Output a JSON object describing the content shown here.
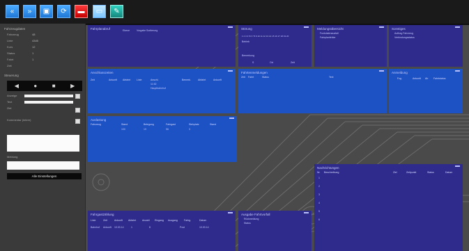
{
  "toolbar": {
    "buttons": [
      {
        "icon": "double-chevron-left-icon"
      },
      {
        "icon": "double-chevron-right-icon"
      },
      {
        "icon": "save-icon"
      },
      {
        "icon": "refresh-icon"
      },
      {
        "icon": "delete-icon"
      },
      {
        "icon": "window-icon"
      },
      {
        "icon": "edit-icon"
      }
    ]
  },
  "left": {
    "section1": "Fahrzeugdaten",
    "fields": [
      {
        "label": "Fahrzeug",
        "value": "48"
      },
      {
        "label": "Linie",
        "value": "4345"
      },
      {
        "label": "Kurs",
        "value": "12"
      },
      {
        "label": "Status",
        "value": "1"
      },
      {
        "label": "Fahrt",
        "value": "1"
      },
      {
        "label": "Zeit",
        "value": ""
      }
    ],
    "section2": "Steuerung",
    "f1": "Anzeige",
    "f2": "Text",
    "f3": "Ziel",
    "comment_label": "Kommentar (intern)",
    "text_label": "Meldung",
    "btn": "Alle Einstellungen"
  },
  "panels": {
    "p1_title": "Fahrplanabruf",
    "p1_sub1": "Ebene",
    "p1_sub2": "Vorgabe Sortierung",
    "p2_title": "Störung",
    "p2_row1": "1 2 3 4 5 6 7 8 9 10 11 12 13 14 15 16 17 18 19 20",
    "p2_row2": "Betrieb",
    "p2_row3": "Bemerkung",
    "p2_cols": [
      "S",
      "Ort",
      "Zeit"
    ],
    "p3_title": "Meldungsübersicht",
    "p3_rows": [
      "Funkdatenausfall",
      "Fahrplanfehler"
    ],
    "p4_title": "Sonstiges",
    "p4_rows": [
      "Auftrag Fahrzeug",
      "Verbindungsstatus"
    ],
    "p5_title": "Anschlusszeiten",
    "p5_cols": [
      "Zeit",
      "Ankunft",
      "Abfahrt",
      "Linie",
      "Anschl.",
      "Bemerk.",
      "Abfahrt",
      "Ankunft"
    ],
    "p5_rows": [
      "11:52",
      "Hauptbahnhof"
    ],
    "p6_title": "Fahrtenmeldungen",
    "p6_cols": [
      "Zeit",
      "Fahrt",
      "Status",
      "Text"
    ],
    "p7_title": "Anmeldung",
    "p7_cols": [
      "Fzg.",
      "Ankunft",
      "Ab",
      "Fahrtstatus"
    ],
    "p8_title": "Auslastung",
    "p8_cols": [
      "Fahrzeug",
      "Stand",
      "Belegung",
      "Fahrgast",
      "Stehplatz",
      "Stand"
    ],
    "p8_vals": [
      "100",
      "19",
      "56",
      "3"
    ],
    "p9_title": "Nachrichtungen",
    "p9_cols": [
      "Nr.",
      "Beschreibung",
      "Ziel",
      "Zeitpunkt",
      "Status",
      "Datum"
    ],
    "p9_nums": [
      "1",
      "2",
      "3",
      "4",
      "5",
      "6"
    ],
    "p10_title": "Fahrgastzählung",
    "p10_cols": [
      "Linie",
      "Zeit",
      "Ankunft",
      "Abfahrt",
      "Anzahl",
      "Eingang",
      "Ausgang",
      "Fahrg.",
      "Datum"
    ],
    "p10_vals": [
      "Bahnhof",
      "Ankunft",
      "10.03.14",
      "1",
      "8",
      "Post",
      "10.03.14"
    ],
    "p11_title": "Ausgabe Fahrtvorfall",
    "p11_rows": [
      "Rückmeldung",
      "Status"
    ]
  },
  "colors": {
    "background": "#4a4a4a",
    "toolbar": "#1a1a1a",
    "panel_purple": "#2f2b8c",
    "panel_blue": "#1d52c4",
    "button_blue": "#1f78d6",
    "button_red": "#c40000"
  }
}
